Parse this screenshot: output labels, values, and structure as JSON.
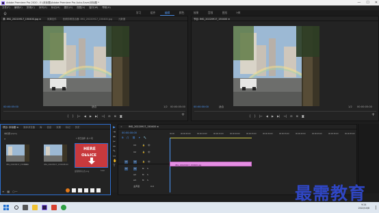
{
  "window": {
    "title": "Adobe Premiere Pro 2020 - E:\\未标题\\Adobe Premiere Pro Auto-Save\\未标题 *",
    "minimize": "—",
    "maximize": "☐",
    "close": "✕"
  },
  "menu": [
    "文件(F)",
    "编辑(E)",
    "剪辑(C)",
    "序列(S)",
    "标记(M)",
    "图形(G)",
    "视图(V)",
    "窗口(W)",
    "帮助(H)"
  ],
  "workspaces": [
    {
      "label": "学习",
      "active": false
    },
    {
      "label": "组件",
      "active": false
    },
    {
      "label": "编辑",
      "active": true
    },
    {
      "label": "颜色",
      "active": false
    },
    {
      "label": "效果",
      "active": false
    },
    {
      "label": "音频",
      "active": false
    },
    {
      "label": "图形",
      "active": false
    },
    {
      "label": "库",
      "active": false
    }
  ],
  "workspace_more": "»",
  "source_monitor": {
    "tabs": [
      "源: IMG_20220917_150400.jpg ≡",
      "效果控件",
      "音频剪辑混合器: IMG_20220917_150400.jpg",
      "元数据"
    ],
    "timecode": "00:00:05:00",
    "fit": "适合",
    "page": "1/2",
    "duration": "00:00:05:00"
  },
  "program_monitor": {
    "tab": "节目: IMG_20220917_150400 ≡",
    "timecode": "00:00:00:00",
    "fit": "适合",
    "page": "1/2",
    "duration": "00:00:05:00"
  },
  "transport_icons": [
    "{",
    "}",
    "|←",
    "◀",
    "▶",
    "▶|",
    "→|",
    "⊟",
    "⊞",
    "◙"
  ],
  "project": {
    "tabs": [
      "项目: 未标题 ≡",
      "媒体浏览器",
      "库",
      "信息",
      "效果",
      "标记",
      "历史"
    ],
    "path": "未标题.prproj",
    "search_placeholder": "",
    "count": "1 项已选择, 共 3 项",
    "items": [
      {
        "name": "IMG_20220917_150400...",
        "duration": "5:00"
      },
      {
        "name": "IMG_20220917_150400",
        "duration": "5:00"
      },
      {
        "name": "最需教育标志.png",
        "duration": "5:00"
      }
    ],
    "sign_top": "HERE",
    "sign_bottom": "OFFICE"
  },
  "timeline": {
    "tab": "IMG_20220917_150400 ≡",
    "timecode": "00:00:00:00",
    "ruler": [
      "00:00",
      "00:00:05:00",
      "00:00:10:00",
      "00:00:15:00",
      "00:00:20:00",
      "00:00:25:00",
      "00:00:30:00",
      "00:00:35:00",
      "00:00:40:00",
      "00:00:45:00",
      "00:00:50:00",
      "00:00:55:00"
    ],
    "video_tracks": [
      "V3",
      "V2",
      "V1"
    ],
    "audio_tracks": [
      "A1",
      "A2",
      "A3"
    ],
    "master": "主声道",
    "master_value": "0.0",
    "clip_label": "IMG_20220917_150400.jpg"
  },
  "watermark": "最需教育",
  "taskbar": {
    "time": "9:24",
    "date": "2022/10/8"
  },
  "colors": {
    "accent": "#4d9bff",
    "clip": "#e58fe3",
    "watermark": "#2f46c4"
  }
}
